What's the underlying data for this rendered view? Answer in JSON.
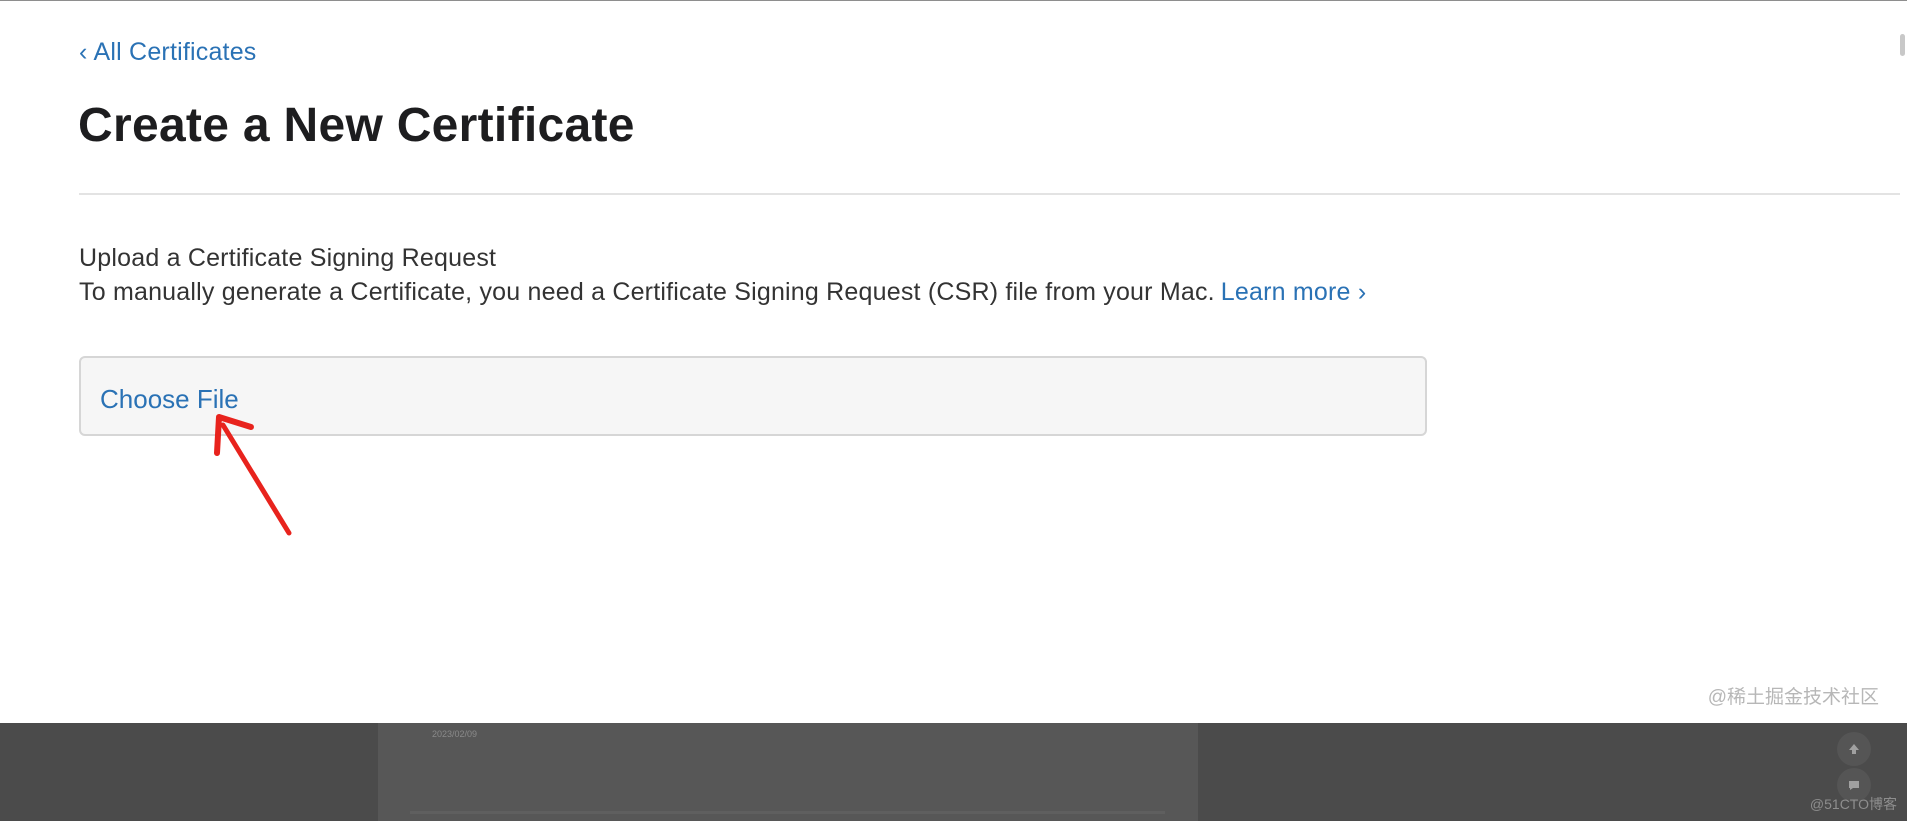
{
  "nav": {
    "back_chevron": "‹",
    "back_label": "All Certificates"
  },
  "page": {
    "title": "Create a New Certificate"
  },
  "upload_section": {
    "title": "Upload a Certificate Signing Request",
    "description": "To manually generate a Certificate, you need a Certificate Signing Request (CSR) file from your Mac.",
    "learn_more_label": "Learn more",
    "learn_more_chevron": "›",
    "choose_file_label": "Choose File"
  },
  "annotation": {
    "arrow_color": "#e8231d"
  },
  "watermarks": {
    "primary": "@稀土掘金技术社区",
    "secondary": "@51CTO博客"
  },
  "background_page": {
    "row_date": "2023/02/09",
    "scroll_top_icon": "arrow-up-icon",
    "chat_icon": "chat-bubble-icon"
  },
  "colors": {
    "link": "#2a72b5",
    "title": "#1d1d1f",
    "body_text": "#333333",
    "upload_border": "#d6d6d6",
    "upload_bg": "#f6f6f6",
    "overlay": "#4b4b4b"
  }
}
